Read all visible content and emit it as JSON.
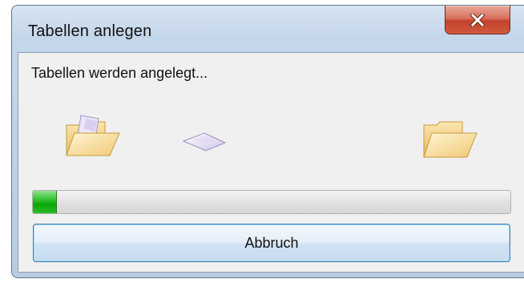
{
  "window": {
    "title": "Tabellen anlegen"
  },
  "dialog": {
    "message": "Tabellen werden angelegt...",
    "progress": 0.05,
    "cancel_label": "Abbruch"
  },
  "icons": {
    "close": "close-icon",
    "source_folder": "folder-icon",
    "document": "document-icon",
    "destination_folder": "folder-icon"
  },
  "colors": {
    "progress": "#08a808",
    "close_button": "#c3412c",
    "titlebar": "#c4d6ea",
    "client_background": "#f0f0f0"
  }
}
